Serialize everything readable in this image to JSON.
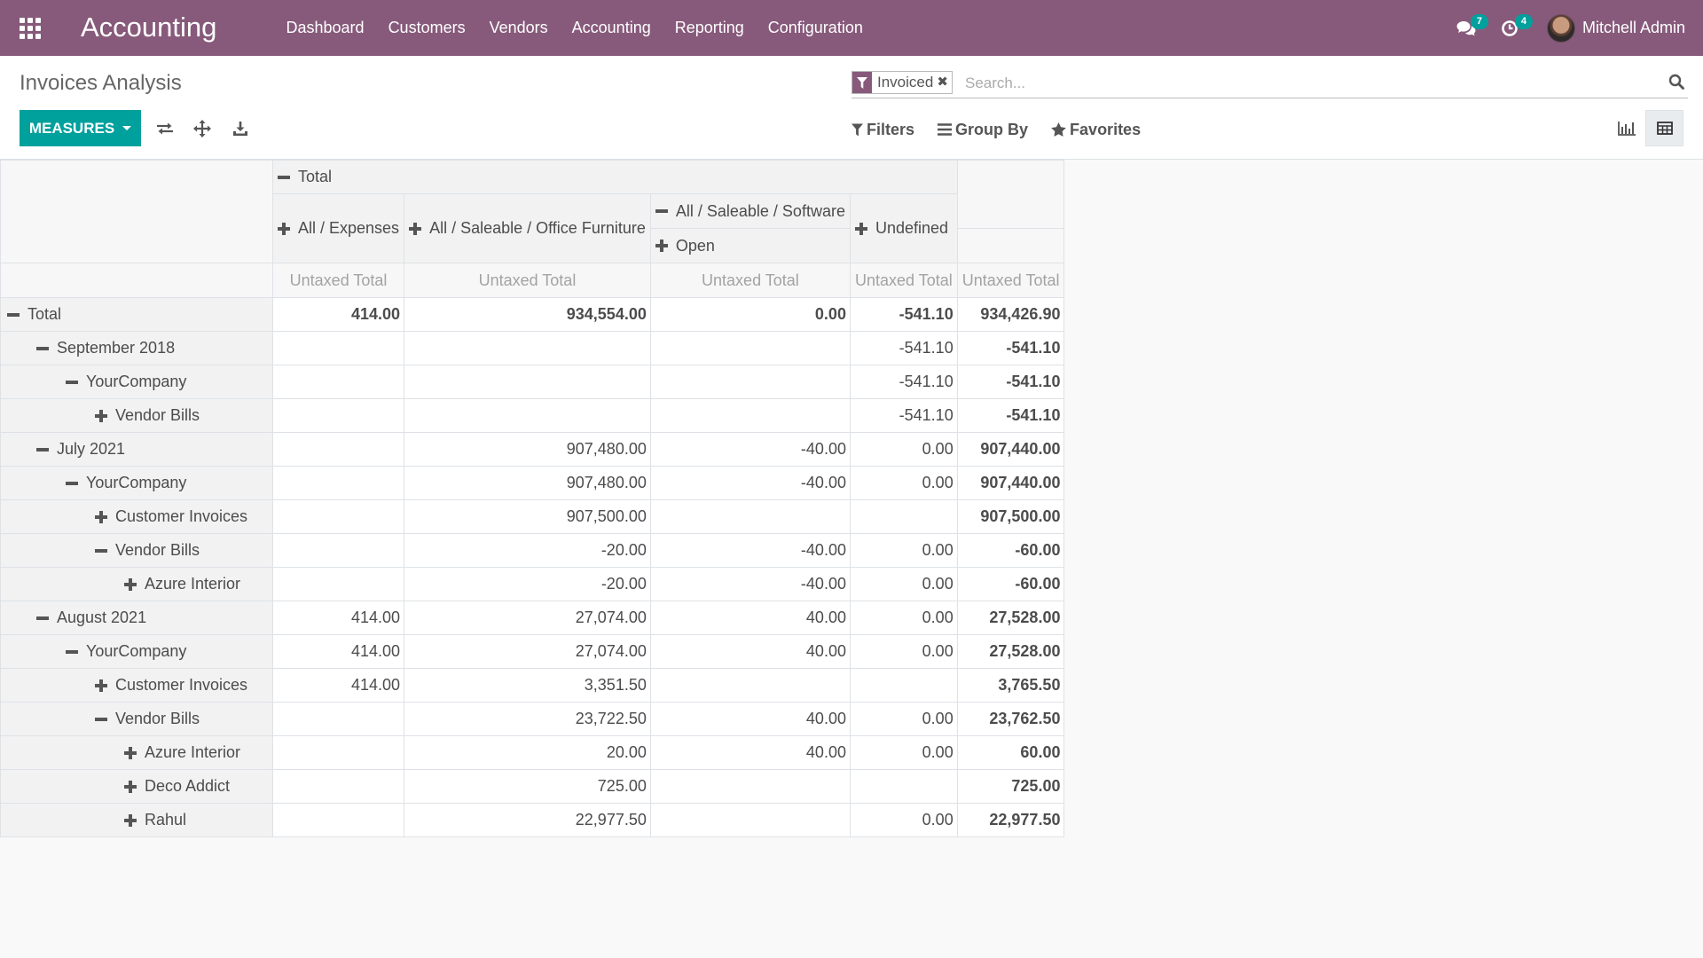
{
  "app": {
    "brand": "Accounting"
  },
  "menu": [
    "Dashboard",
    "Customers",
    "Vendors",
    "Accounting",
    "Reporting",
    "Configuration"
  ],
  "systray": {
    "messages_count": "7",
    "activities_count": "4",
    "user_name": "Mitchell Admin"
  },
  "breadcrumb": "Invoices Analysis",
  "search": {
    "facet": "Invoiced",
    "facet_remove": "✖",
    "placeholder": "Search..."
  },
  "toolbar": {
    "measures_label": "MEASURES"
  },
  "search_options": {
    "filters": "Filters",
    "group_by": "Group By",
    "favorites": "Favorites"
  },
  "pivot": {
    "col_total": "Total",
    "col_groups": [
      "All / Expenses",
      "All / Saleable / Office Furniture",
      "All / Saleable / Software",
      "Undefined"
    ],
    "col_subgroup": "Open",
    "measure": "Untaxed Total",
    "rows": [
      {
        "label": "Total",
        "level": 0,
        "sign": "minus",
        "values": [
          "414.00",
          "934,554.00",
          "0.00",
          "-541.10",
          "934,426.90"
        ]
      },
      {
        "label": "September 2018",
        "level": 1,
        "sign": "minus",
        "values": [
          "",
          "",
          "",
          "-541.10",
          "-541.10"
        ]
      },
      {
        "label": "YourCompany",
        "level": 2,
        "sign": "minus",
        "values": [
          "",
          "",
          "",
          "-541.10",
          "-541.10"
        ]
      },
      {
        "label": "Vendor Bills",
        "level": 3,
        "sign": "plus",
        "values": [
          "",
          "",
          "",
          "-541.10",
          "-541.10"
        ]
      },
      {
        "label": "July 2021",
        "level": 1,
        "sign": "minus",
        "values": [
          "",
          "907,480.00",
          "-40.00",
          "0.00",
          "907,440.00"
        ]
      },
      {
        "label": "YourCompany",
        "level": 2,
        "sign": "minus",
        "values": [
          "",
          "907,480.00",
          "-40.00",
          "0.00",
          "907,440.00"
        ]
      },
      {
        "label": "Customer Invoices",
        "level": 3,
        "sign": "plus",
        "values": [
          "",
          "907,500.00",
          "",
          "",
          "907,500.00"
        ]
      },
      {
        "label": "Vendor Bills",
        "level": 3,
        "sign": "minus",
        "values": [
          "",
          "-20.00",
          "-40.00",
          "0.00",
          "-60.00"
        ]
      },
      {
        "label": "Azure Interior",
        "level": 4,
        "sign": "plus",
        "values": [
          "",
          "-20.00",
          "-40.00",
          "0.00",
          "-60.00"
        ]
      },
      {
        "label": "August 2021",
        "level": 1,
        "sign": "minus",
        "values": [
          "414.00",
          "27,074.00",
          "40.00",
          "0.00",
          "27,528.00"
        ]
      },
      {
        "label": "YourCompany",
        "level": 2,
        "sign": "minus",
        "values": [
          "414.00",
          "27,074.00",
          "40.00",
          "0.00",
          "27,528.00"
        ]
      },
      {
        "label": "Customer Invoices",
        "level": 3,
        "sign": "plus",
        "values": [
          "414.00",
          "3,351.50",
          "",
          "",
          "3,765.50"
        ]
      },
      {
        "label": "Vendor Bills",
        "level": 3,
        "sign": "minus",
        "values": [
          "",
          "23,722.50",
          "40.00",
          "0.00",
          "23,762.50"
        ]
      },
      {
        "label": "Azure Interior",
        "level": 4,
        "sign": "plus",
        "values": [
          "",
          "20.00",
          "40.00",
          "0.00",
          "60.00"
        ]
      },
      {
        "label": "Deco Addict",
        "level": 4,
        "sign": "plus",
        "values": [
          "",
          "725.00",
          "",
          "",
          "725.00"
        ]
      },
      {
        "label": "Rahul",
        "level": 4,
        "sign": "plus",
        "values": [
          "",
          "22,977.50",
          "",
          "0.00",
          "22,977.50"
        ]
      }
    ]
  },
  "colors": {
    "navbar": "#875a7b",
    "primary": "#00a09d"
  }
}
